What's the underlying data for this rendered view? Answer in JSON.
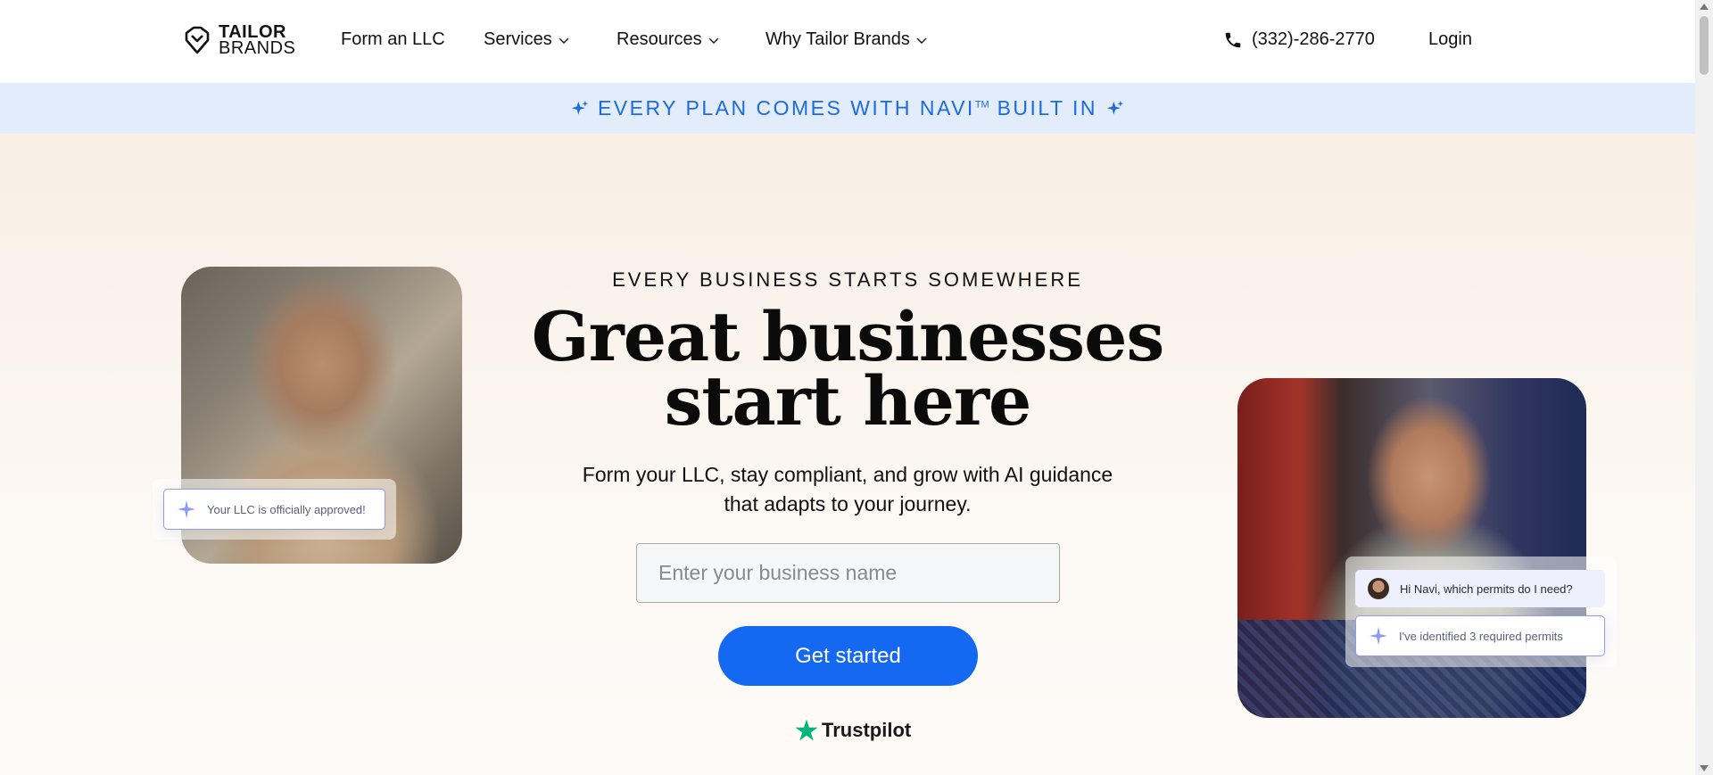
{
  "nav": {
    "logo_line1": "TAILOR",
    "logo_line2": "BRANDS",
    "links": [
      {
        "label": "Form an LLC",
        "has_dropdown": false
      },
      {
        "label": "Services",
        "has_dropdown": true
      },
      {
        "label": "Resources",
        "has_dropdown": true
      },
      {
        "label": "Why Tailor Brands",
        "has_dropdown": true
      }
    ],
    "phone": "(332)-286-2770",
    "login": "Login"
  },
  "banner": {
    "text_before": "EVERY PLAN COMES WITH NAVI",
    "trademark": "TM",
    "text_after": " BUILT IN",
    "color": "#1c6be0",
    "background": "#e3ecfb"
  },
  "hero": {
    "eyebrow": "EVERY BUSINESS STARTS SOMEWHERE",
    "headline_line1": "Great businesses",
    "headline_line2": "start here",
    "subline_line1": "Form your LLC, stay compliant, and grow with AI guidance",
    "subline_line2": "that adapts to your journey.",
    "input_placeholder": "Enter your business name",
    "cta_label": "Get started",
    "cta_color": "#1468f2",
    "trustpilot_label": "Trustpilot",
    "trustpilot_color": "#00b67a"
  },
  "left_card": {
    "chip_text": "Your LLC is officially approved!"
  },
  "right_card": {
    "question": "Hi Navi, which permits do I need?",
    "answer": "I've identified 3 required permits"
  },
  "icons": {
    "logo": "tailor-brands-logo-icon",
    "phone": "phone-icon",
    "sparkle": "sparkle-icon",
    "chevron": "chevron-down-icon",
    "star": "trustpilot-star-icon"
  }
}
